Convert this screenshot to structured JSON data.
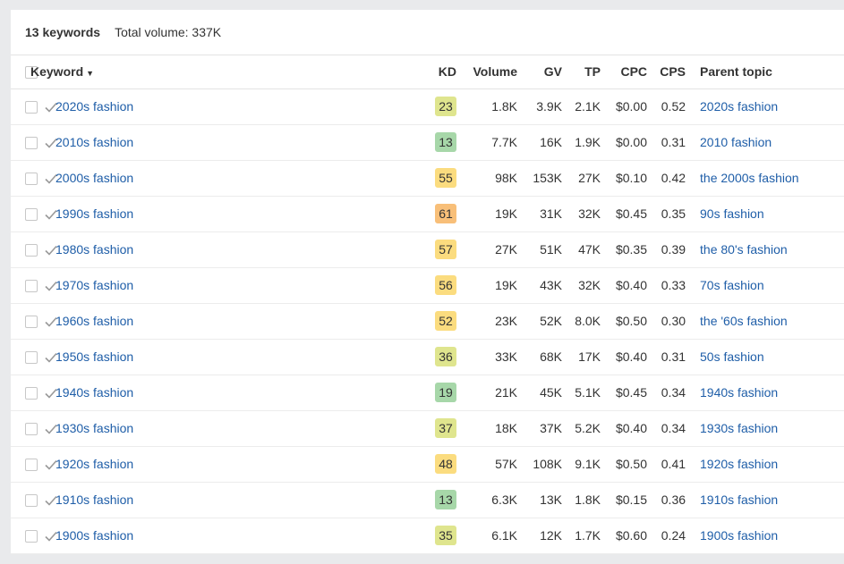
{
  "summary": {
    "count_label": "13 keywords",
    "total_label": "Total volume: 337K"
  },
  "columns": {
    "keyword": "Keyword",
    "kd": "KD",
    "volume": "Volume",
    "gv": "GV",
    "tp": "TP",
    "cpc": "CPC",
    "cps": "CPS",
    "parent": "Parent topic"
  },
  "sort_arrow": "▼",
  "kd_colors": {
    "green": "#a7d7a9",
    "lime": "#dfe58e",
    "yellow": "#fbdc7f",
    "orange": "#f8bf79"
  },
  "rows": [
    {
      "keyword": "2020s fashion",
      "kd": "23",
      "kd_color": "#dfe58e",
      "volume": "1.8K",
      "gv": "3.9K",
      "tp": "2.1K",
      "cpc": "$0.00",
      "cps": "0.52",
      "parent": "2020s fashion"
    },
    {
      "keyword": "2010s fashion",
      "kd": "13",
      "kd_color": "#a7d7a9",
      "volume": "7.7K",
      "gv": "16K",
      "tp": "1.9K",
      "cpc": "$0.00",
      "cps": "0.31",
      "parent": "2010 fashion"
    },
    {
      "keyword": "2000s fashion",
      "kd": "55",
      "kd_color": "#fbdc7f",
      "volume": "98K",
      "gv": "153K",
      "tp": "27K",
      "cpc": "$0.10",
      "cps": "0.42",
      "parent": "the 2000s fashion"
    },
    {
      "keyword": "1990s fashion",
      "kd": "61",
      "kd_color": "#f8bf79",
      "volume": "19K",
      "gv": "31K",
      "tp": "32K",
      "cpc": "$0.45",
      "cps": "0.35",
      "parent": "90s fashion"
    },
    {
      "keyword": "1980s fashion",
      "kd": "57",
      "kd_color": "#fbdc7f",
      "volume": "27K",
      "gv": "51K",
      "tp": "47K",
      "cpc": "$0.35",
      "cps": "0.39",
      "parent": "the 80's fashion"
    },
    {
      "keyword": "1970s fashion",
      "kd": "56",
      "kd_color": "#fbdc7f",
      "volume": "19K",
      "gv": "43K",
      "tp": "32K",
      "cpc": "$0.40",
      "cps": "0.33",
      "parent": "70s fashion"
    },
    {
      "keyword": "1960s fashion",
      "kd": "52",
      "kd_color": "#fbdc7f",
      "volume": "23K",
      "gv": "52K",
      "tp": "8.0K",
      "cpc": "$0.50",
      "cps": "0.30",
      "parent": "the '60s fashion"
    },
    {
      "keyword": "1950s fashion",
      "kd": "36",
      "kd_color": "#dfe58e",
      "volume": "33K",
      "gv": "68K",
      "tp": "17K",
      "cpc": "$0.40",
      "cps": "0.31",
      "parent": "50s fashion"
    },
    {
      "keyword": "1940s fashion",
      "kd": "19",
      "kd_color": "#a7d7a9",
      "volume": "21K",
      "gv": "45K",
      "tp": "5.1K",
      "cpc": "$0.45",
      "cps": "0.34",
      "parent": "1940s fashion"
    },
    {
      "keyword": "1930s fashion",
      "kd": "37",
      "kd_color": "#dfe58e",
      "volume": "18K",
      "gv": "37K",
      "tp": "5.2K",
      "cpc": "$0.40",
      "cps": "0.34",
      "parent": "1930s fashion"
    },
    {
      "keyword": "1920s fashion",
      "kd": "48",
      "kd_color": "#fbdc7f",
      "volume": "57K",
      "gv": "108K",
      "tp": "9.1K",
      "cpc": "$0.50",
      "cps": "0.41",
      "parent": "1920s fashion"
    },
    {
      "keyword": "1910s fashion",
      "kd": "13",
      "kd_color": "#a7d7a9",
      "volume": "6.3K",
      "gv": "13K",
      "tp": "1.8K",
      "cpc": "$0.15",
      "cps": "0.36",
      "parent": "1910s fashion"
    },
    {
      "keyword": "1900s fashion",
      "kd": "35",
      "kd_color": "#dfe58e",
      "volume": "6.1K",
      "gv": "12K",
      "tp": "1.7K",
      "cpc": "$0.60",
      "cps": "0.24",
      "parent": "1900s fashion"
    }
  ]
}
